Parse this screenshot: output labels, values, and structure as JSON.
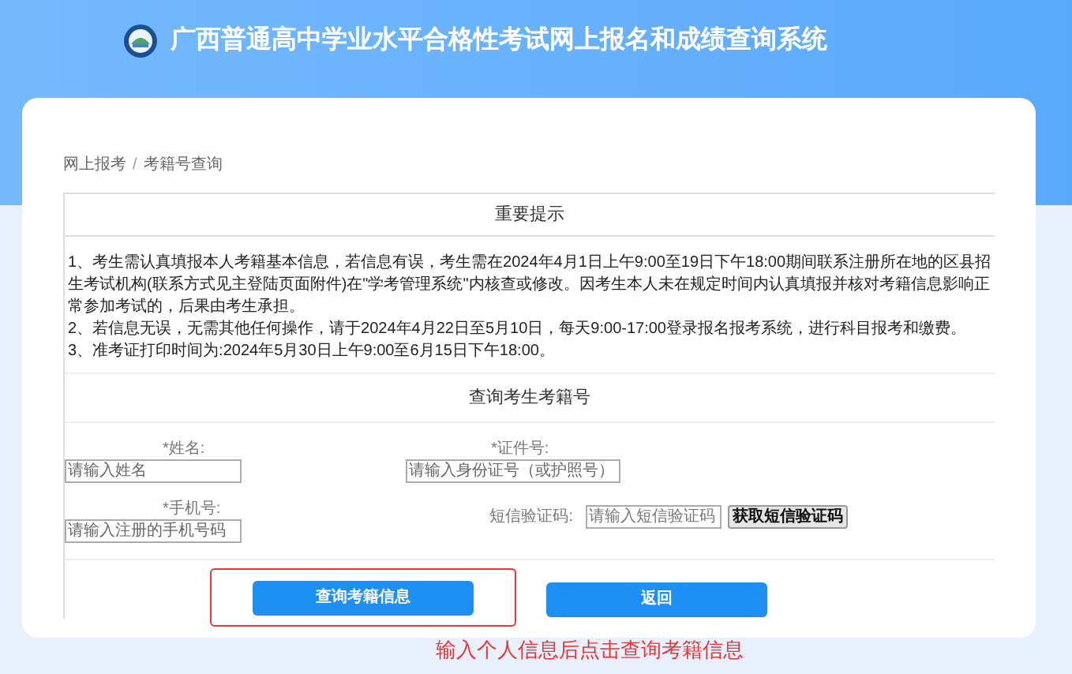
{
  "header": {
    "title": "广西普通高中学业水平合格性考试网上报名和成绩查询系统"
  },
  "breadcrumb": [
    "网上报考",
    "考籍号查询"
  ],
  "breadcrumb_separator": "/",
  "notice": {
    "title": "重要提示",
    "paragraphs": [
      "1、考生需认真填报本人考籍基本信息，若信息有误，考生需在2024年4月1日上午9:00至19日下午18:00期间联系注册所在地的区县招生考试机构(联系方式见主登陆页面附件)在\"学考管理系统\"内核查或修改。因考生本人未在规定时间内认真填报并核对考籍信息影响正常参加考试的，后果由考生承担。",
      "2、若信息无误，无需其他任何操作，请于2024年4月22日至5月10日，每天9:00-17:00登录报名报考系统，进行科目报考和缴费。",
      "3、准考证打印时间为:2024年5月30日上午9:00至6月15日下午18:00。"
    ]
  },
  "query": {
    "title": "查询考生考籍号",
    "fields": [
      {
        "label": "*姓名:",
        "placeholder": "请输入姓名"
      },
      {
        "label": "*证件号:",
        "placeholder": "请输入身份证号（或护照号）"
      },
      {
        "label": "*手机号:",
        "placeholder": "请输入注册的手机号码"
      },
      {
        "label": "短信验证码:",
        "placeholder": "请输入短信验证码",
        "button": "获取短信验证码"
      }
    ]
  },
  "buttons": [
    {
      "label": "查询考籍信息",
      "highlighted": true
    },
    {
      "label": "返回",
      "highlighted": false
    }
  ],
  "annotation": "输入个人信息后点击查询考籍信息"
}
